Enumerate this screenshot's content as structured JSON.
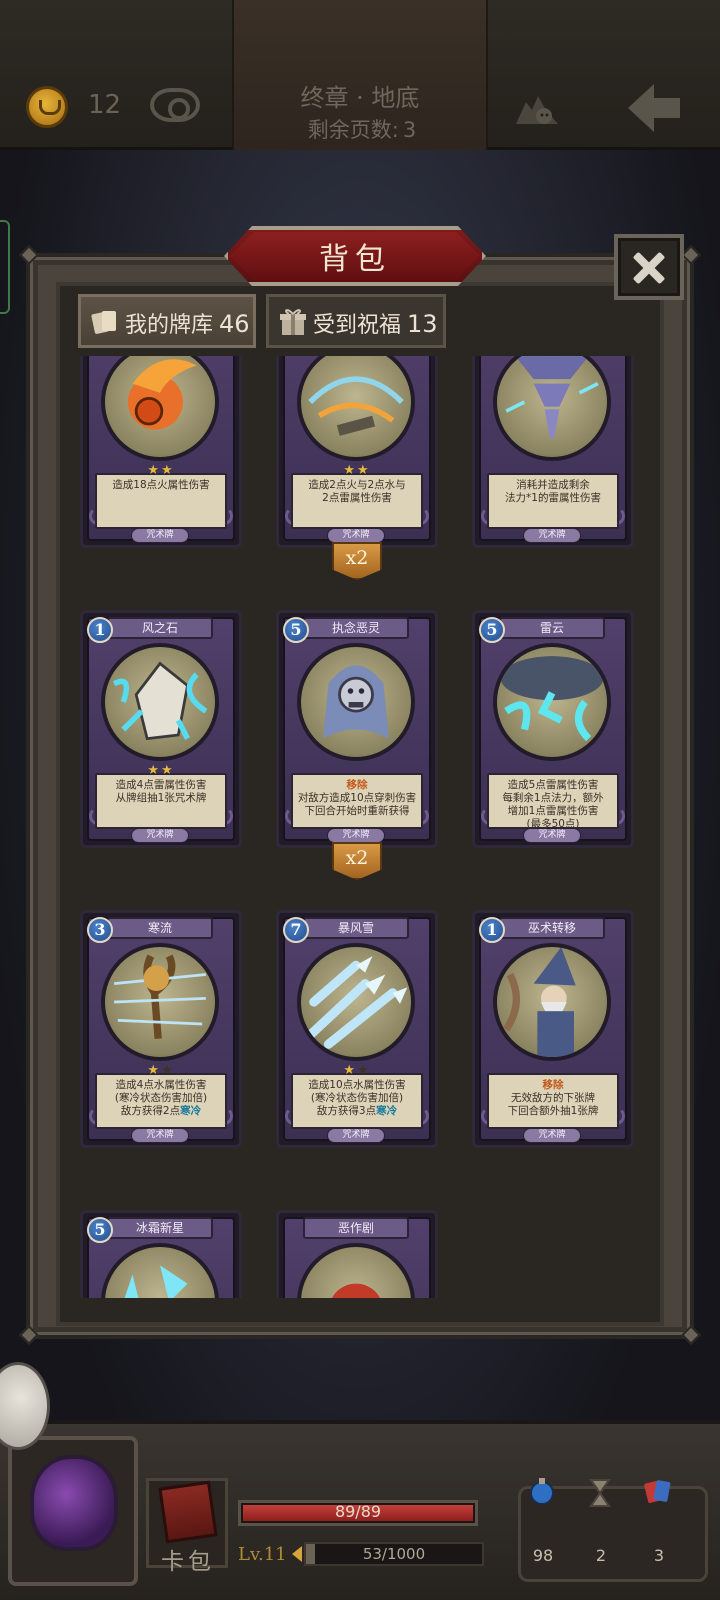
{
  "topbar": {
    "coins": "12",
    "chapter": "终章 · 地底",
    "pages_left_label": "剩余页数:",
    "pages_left_value": "3"
  },
  "modal": {
    "title": "背包",
    "tabs": [
      {
        "label": "我的牌库",
        "count": "46",
        "active": true
      },
      {
        "label": "受到祝福",
        "count": "13",
        "active": false
      }
    ]
  },
  "cards": [
    {
      "name": "",
      "cost": "",
      "stars": 2,
      "max_stars": 2,
      "desc": [
        "造成18点火属性伤害"
      ],
      "type": "咒术牌",
      "art": "fire",
      "dup": ""
    },
    {
      "name": "",
      "cost": "",
      "stars": 2,
      "max_stars": 2,
      "desc": [
        "造成2点火与2点水与",
        "2点雷属性伤害"
      ],
      "type": "咒术牌",
      "art": "storm",
      "dup": "x2"
    },
    {
      "name": "",
      "cost": "",
      "stars": 0,
      "max_stars": 0,
      "desc": [
        "消耗并造成剩余",
        "法力*1的雷属性伤害"
      ],
      "type": "咒术牌",
      "art": "tornado",
      "dup": ""
    },
    {
      "name": "风之石",
      "cost": "1",
      "stars": 2,
      "max_stars": 2,
      "desc": [
        "造成4点雷属性伤害",
        "从牌组抽1张咒术牌"
      ],
      "type": "咒术牌",
      "art": "stone",
      "dup": ""
    },
    {
      "name": "执念恶灵",
      "cost": "5",
      "stars": 0,
      "max_stars": 0,
      "keyword": "移除",
      "desc": [
        "对敌方造成10点穿刺伤害",
        "下回合开始时重新获得"
      ],
      "type": "咒术牌",
      "art": "ghost",
      "dup": "x2"
    },
    {
      "name": "雷云",
      "cost": "5",
      "stars": 0,
      "max_stars": 0,
      "desc": [
        "造成5点雷属性伤害",
        "每剩余1点法力，额外",
        "增加1点雷属性伤害",
        "(最多50点)"
      ],
      "type": "咒术牌",
      "art": "cloud",
      "dup": ""
    },
    {
      "name": "寒流",
      "cost": "3",
      "stars": 1,
      "max_stars": 2,
      "desc": [
        "造成4点水属性伤害",
        "(寒冷状态伤害加倍)"
      ],
      "desc_tail": "敌方获得2点",
      "desc_tail_hl": "寒冷",
      "type": "咒术牌",
      "art": "cold",
      "dup": ""
    },
    {
      "name": "暴风雪",
      "cost": "7",
      "stars": 1,
      "max_stars": 2,
      "desc": [
        "造成10点水属性伤害",
        "(寒冷状态伤害加倍)"
      ],
      "desc_tail": "敌方获得3点",
      "desc_tail_hl": "寒冷",
      "type": "咒术牌",
      "art": "blizzard",
      "dup": ""
    },
    {
      "name": "巫术转移",
      "cost": "1",
      "stars": 0,
      "max_stars": 0,
      "keyword": "移除",
      "desc": [
        "无效敌方的下张牌",
        "下回合额外抽1张牌"
      ],
      "type": "咒术牌",
      "art": "wizard",
      "dup": ""
    },
    {
      "name": "冰霜新星",
      "cost": "5",
      "stars": 0,
      "max_stars": 0,
      "desc": [],
      "type": "",
      "art": "frost",
      "dup": ""
    },
    {
      "name": "恶作剧",
      "cost": "",
      "stars": 0,
      "max_stars": 0,
      "desc": [],
      "type": "",
      "art": "prank",
      "dup": ""
    }
  ],
  "hud": {
    "hp": "89/89",
    "hp_ratio": 1.0,
    "level": "Lv.11",
    "xp": "53/1000",
    "xp_ratio": 0.053,
    "deck_label": "卡包",
    "resources": [
      {
        "icon": "potion-icon",
        "value": "98"
      },
      {
        "icon": "hourglass-icon",
        "value": "2"
      },
      {
        "icon": "cards-icon",
        "value": "3"
      }
    ]
  }
}
